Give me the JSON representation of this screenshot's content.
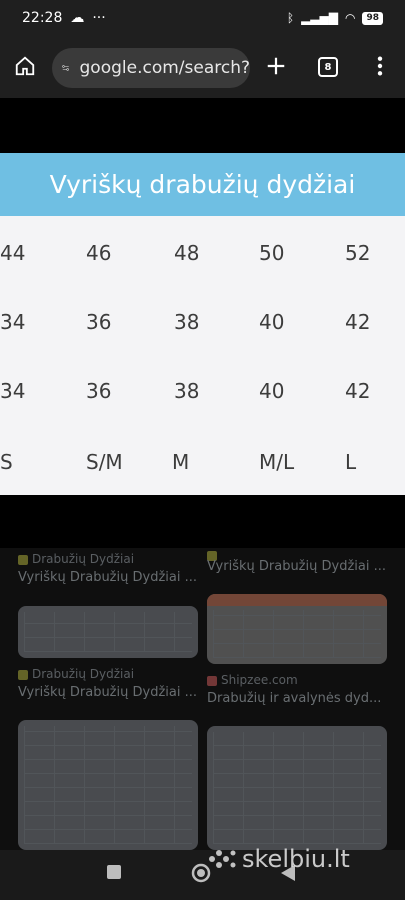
{
  "status": {
    "time": "22:28",
    "dots": "···",
    "battery": "98"
  },
  "browser": {
    "url": "google.com/search?",
    "tab_count": "8"
  },
  "chart": {
    "title": "Vyriškų drabužių dydžiai",
    "rows": [
      [
        "44",
        "46",
        "48",
        "50",
        "52"
      ],
      [
        "34",
        "36",
        "38",
        "40",
        "42"
      ],
      [
        "34",
        "36",
        "38",
        "40",
        "42"
      ],
      [
        "S",
        "S/M",
        "M",
        "M/L",
        "L"
      ]
    ]
  },
  "results": [
    {
      "source": "Drabužių Dydžiai",
      "title": "Vyriškų Drabužių Dydžiai ..."
    },
    {
      "source": "",
      "title": "Vyriškų Drabužių Dydžiai ..."
    },
    {
      "source": "Drabužių Dydžiai",
      "title": "Vyriškų Drabužių Dydžiai ..."
    },
    {
      "source": "Shipzee.com",
      "title": "Drabužių ir avalynės dyd..."
    }
  ],
  "watermark": "skelbiu.lt"
}
